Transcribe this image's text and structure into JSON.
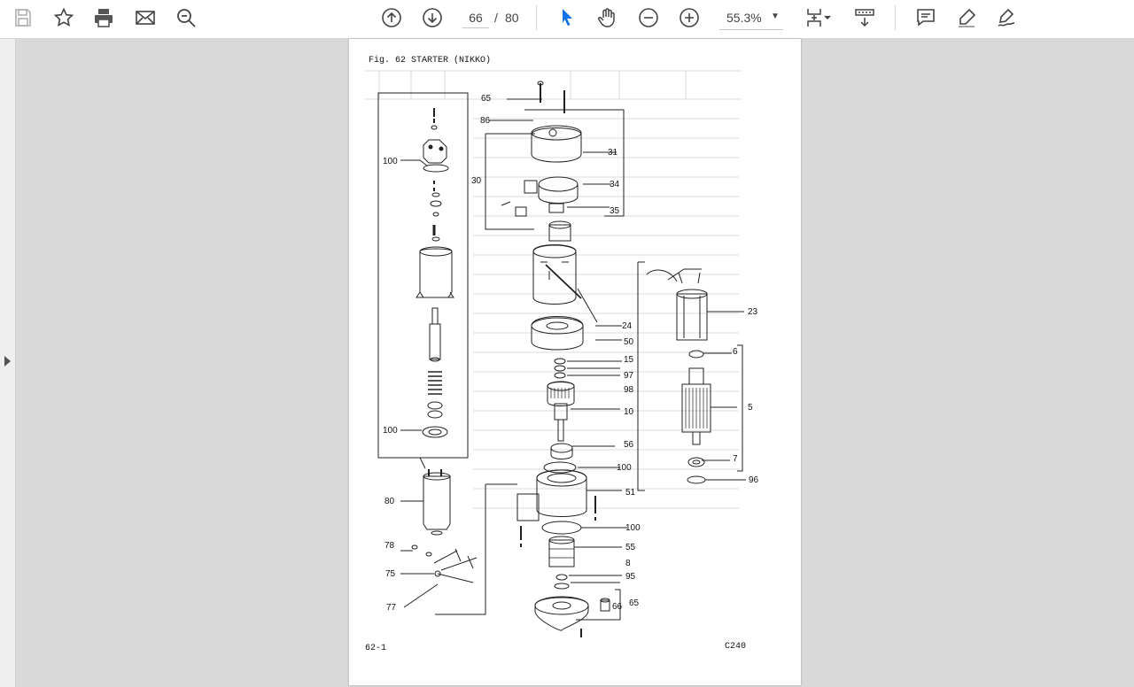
{
  "toolbar": {
    "page_current": "66",
    "page_separator": "/",
    "page_total": "80",
    "zoom": "55.3%",
    "icons": [
      "save-icon",
      "bookmark-star-icon",
      "print-icon",
      "email-icon",
      "zoom-search-icon",
      "page-up-icon",
      "page-down-icon",
      "select-pointer-icon",
      "hand-pan-icon",
      "zoom-out-icon",
      "zoom-in-icon",
      "fit-page-icon",
      "scroll-mode-icon",
      "comment-icon",
      "highlight-pen-icon",
      "sign-icon"
    ],
    "accent_color": "#1473e6"
  },
  "document": {
    "figure_title": "Fig. 62  STARTER (NIKKO)",
    "footer_left": "62-1",
    "footer_right": "C240",
    "callouts": [
      "65",
      "86",
      "31",
      "30",
      "34",
      "35",
      "100",
      "24",
      "50",
      "15",
      "97",
      "98",
      "10",
      "56",
      "100",
      "51",
      "100",
      "55",
      "8",
      "95",
      "65",
      "66",
      "23",
      "6",
      "5",
      "7",
      "96",
      "100",
      "80",
      "78",
      "75",
      "77"
    ]
  }
}
